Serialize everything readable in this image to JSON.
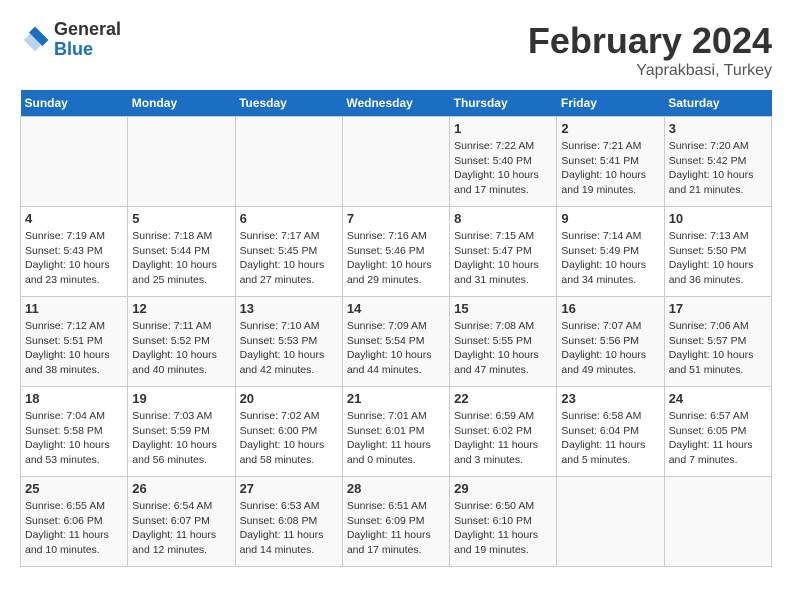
{
  "logo": {
    "general": "General",
    "blue": "Blue"
  },
  "title": "February 2024",
  "subtitle": "Yaprakbasi, Turkey",
  "days_of_week": [
    "Sunday",
    "Monday",
    "Tuesday",
    "Wednesday",
    "Thursday",
    "Friday",
    "Saturday"
  ],
  "weeks": [
    [
      {
        "day": "",
        "info": ""
      },
      {
        "day": "",
        "info": ""
      },
      {
        "day": "",
        "info": ""
      },
      {
        "day": "",
        "info": ""
      },
      {
        "day": "1",
        "info": "Sunrise: 7:22 AM\nSunset: 5:40 PM\nDaylight: 10 hours and 17 minutes."
      },
      {
        "day": "2",
        "info": "Sunrise: 7:21 AM\nSunset: 5:41 PM\nDaylight: 10 hours and 19 minutes."
      },
      {
        "day": "3",
        "info": "Sunrise: 7:20 AM\nSunset: 5:42 PM\nDaylight: 10 hours and 21 minutes."
      }
    ],
    [
      {
        "day": "4",
        "info": "Sunrise: 7:19 AM\nSunset: 5:43 PM\nDaylight: 10 hours and 23 minutes."
      },
      {
        "day": "5",
        "info": "Sunrise: 7:18 AM\nSunset: 5:44 PM\nDaylight: 10 hours and 25 minutes."
      },
      {
        "day": "6",
        "info": "Sunrise: 7:17 AM\nSunset: 5:45 PM\nDaylight: 10 hours and 27 minutes."
      },
      {
        "day": "7",
        "info": "Sunrise: 7:16 AM\nSunset: 5:46 PM\nDaylight: 10 hours and 29 minutes."
      },
      {
        "day": "8",
        "info": "Sunrise: 7:15 AM\nSunset: 5:47 PM\nDaylight: 10 hours and 31 minutes."
      },
      {
        "day": "9",
        "info": "Sunrise: 7:14 AM\nSunset: 5:49 PM\nDaylight: 10 hours and 34 minutes."
      },
      {
        "day": "10",
        "info": "Sunrise: 7:13 AM\nSunset: 5:50 PM\nDaylight: 10 hours and 36 minutes."
      }
    ],
    [
      {
        "day": "11",
        "info": "Sunrise: 7:12 AM\nSunset: 5:51 PM\nDaylight: 10 hours and 38 minutes."
      },
      {
        "day": "12",
        "info": "Sunrise: 7:11 AM\nSunset: 5:52 PM\nDaylight: 10 hours and 40 minutes."
      },
      {
        "day": "13",
        "info": "Sunrise: 7:10 AM\nSunset: 5:53 PM\nDaylight: 10 hours and 42 minutes."
      },
      {
        "day": "14",
        "info": "Sunrise: 7:09 AM\nSunset: 5:54 PM\nDaylight: 10 hours and 44 minutes."
      },
      {
        "day": "15",
        "info": "Sunrise: 7:08 AM\nSunset: 5:55 PM\nDaylight: 10 hours and 47 minutes."
      },
      {
        "day": "16",
        "info": "Sunrise: 7:07 AM\nSunset: 5:56 PM\nDaylight: 10 hours and 49 minutes."
      },
      {
        "day": "17",
        "info": "Sunrise: 7:06 AM\nSunset: 5:57 PM\nDaylight: 10 hours and 51 minutes."
      }
    ],
    [
      {
        "day": "18",
        "info": "Sunrise: 7:04 AM\nSunset: 5:58 PM\nDaylight: 10 hours and 53 minutes."
      },
      {
        "day": "19",
        "info": "Sunrise: 7:03 AM\nSunset: 5:59 PM\nDaylight: 10 hours and 56 minutes."
      },
      {
        "day": "20",
        "info": "Sunrise: 7:02 AM\nSunset: 6:00 PM\nDaylight: 10 hours and 58 minutes."
      },
      {
        "day": "21",
        "info": "Sunrise: 7:01 AM\nSunset: 6:01 PM\nDaylight: 11 hours and 0 minutes."
      },
      {
        "day": "22",
        "info": "Sunrise: 6:59 AM\nSunset: 6:02 PM\nDaylight: 11 hours and 3 minutes."
      },
      {
        "day": "23",
        "info": "Sunrise: 6:58 AM\nSunset: 6:04 PM\nDaylight: 11 hours and 5 minutes."
      },
      {
        "day": "24",
        "info": "Sunrise: 6:57 AM\nSunset: 6:05 PM\nDaylight: 11 hours and 7 minutes."
      }
    ],
    [
      {
        "day": "25",
        "info": "Sunrise: 6:55 AM\nSunset: 6:06 PM\nDaylight: 11 hours and 10 minutes."
      },
      {
        "day": "26",
        "info": "Sunrise: 6:54 AM\nSunset: 6:07 PM\nDaylight: 11 hours and 12 minutes."
      },
      {
        "day": "27",
        "info": "Sunrise: 6:53 AM\nSunset: 6:08 PM\nDaylight: 11 hours and 14 minutes."
      },
      {
        "day": "28",
        "info": "Sunrise: 6:51 AM\nSunset: 6:09 PM\nDaylight: 11 hours and 17 minutes."
      },
      {
        "day": "29",
        "info": "Sunrise: 6:50 AM\nSunset: 6:10 PM\nDaylight: 11 hours and 19 minutes."
      },
      {
        "day": "",
        "info": ""
      },
      {
        "day": "",
        "info": ""
      }
    ]
  ]
}
